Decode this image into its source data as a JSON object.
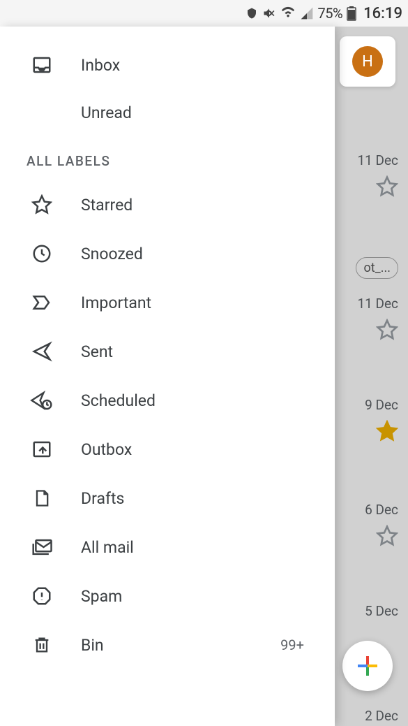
{
  "status_bar": {
    "battery_pct": "75%",
    "time": "16:19"
  },
  "drawer": {
    "top_items": [
      {
        "label": "Inbox",
        "icon": "inbox-icon"
      },
      {
        "label": "Unread",
        "icon": ""
      }
    ],
    "section_label": "ALL LABELS",
    "label_items": [
      {
        "label": "Starred",
        "icon": "star-icon",
        "count": ""
      },
      {
        "label": "Snoozed",
        "icon": "clock-icon",
        "count": ""
      },
      {
        "label": "Important",
        "icon": "important-icon",
        "count": ""
      },
      {
        "label": "Sent",
        "icon": "sent-icon",
        "count": ""
      },
      {
        "label": "Scheduled",
        "icon": "scheduled-icon",
        "count": ""
      },
      {
        "label": "Outbox",
        "icon": "outbox-icon",
        "count": ""
      },
      {
        "label": "Drafts",
        "icon": "drafts-icon",
        "count": ""
      },
      {
        "label": "All mail",
        "icon": "allmail-icon",
        "count": ""
      },
      {
        "label": "Spam",
        "icon": "spam-icon",
        "count": ""
      },
      {
        "label": "Bin",
        "icon": "bin-icon",
        "count": "99+"
      }
    ]
  },
  "bg": {
    "avatar_letter": "H",
    "chip_text": "ot_...",
    "dates": [
      "11 Dec",
      "11 Dec",
      "9 Dec",
      "6 Dec",
      "5 Dec",
      "2 Dec"
    ]
  }
}
